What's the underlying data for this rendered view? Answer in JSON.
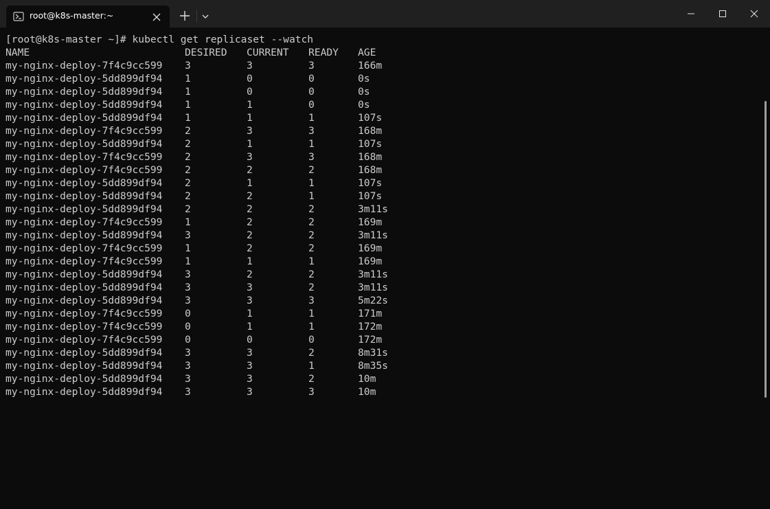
{
  "window": {
    "tab_title": "root@k8s-master:~",
    "icons": {
      "tab": "powershell-terminal-icon",
      "tab_close": "close-icon",
      "new_tab": "plus-icon",
      "dropdown": "chevron-down-icon",
      "minimize": "minimize-icon",
      "maximize": "maximize-icon",
      "close": "close-icon"
    }
  },
  "terminal": {
    "command_line": "[root@k8s-master ~]# kubectl get replicaset --watch",
    "headers": {
      "name": "NAME",
      "desired": "DESIRED",
      "current": "CURRENT",
      "ready": "READY",
      "age": "AGE"
    },
    "rows": [
      {
        "name": "my-nginx-deploy-7f4c9cc599",
        "desired": "3",
        "current": "3",
        "ready": "3",
        "age": "166m"
      },
      {
        "name": "my-nginx-deploy-5dd899df94",
        "desired": "1",
        "current": "0",
        "ready": "0",
        "age": "0s"
      },
      {
        "name": "my-nginx-deploy-5dd899df94",
        "desired": "1",
        "current": "0",
        "ready": "0",
        "age": "0s"
      },
      {
        "name": "my-nginx-deploy-5dd899df94",
        "desired": "1",
        "current": "1",
        "ready": "0",
        "age": "0s"
      },
      {
        "name": "my-nginx-deploy-5dd899df94",
        "desired": "1",
        "current": "1",
        "ready": "1",
        "age": "107s"
      },
      {
        "name": "my-nginx-deploy-7f4c9cc599",
        "desired": "2",
        "current": "3",
        "ready": "3",
        "age": "168m"
      },
      {
        "name": "my-nginx-deploy-5dd899df94",
        "desired": "2",
        "current": "1",
        "ready": "1",
        "age": "107s"
      },
      {
        "name": "my-nginx-deploy-7f4c9cc599",
        "desired": "2",
        "current": "3",
        "ready": "3",
        "age": "168m"
      },
      {
        "name": "my-nginx-deploy-7f4c9cc599",
        "desired": "2",
        "current": "2",
        "ready": "2",
        "age": "168m"
      },
      {
        "name": "my-nginx-deploy-5dd899df94",
        "desired": "2",
        "current": "1",
        "ready": "1",
        "age": "107s"
      },
      {
        "name": "my-nginx-deploy-5dd899df94",
        "desired": "2",
        "current": "2",
        "ready": "1",
        "age": "107s"
      },
      {
        "name": "my-nginx-deploy-5dd899df94",
        "desired": "2",
        "current": "2",
        "ready": "2",
        "age": "3m11s"
      },
      {
        "name": "my-nginx-deploy-7f4c9cc599",
        "desired": "1",
        "current": "2",
        "ready": "2",
        "age": "169m"
      },
      {
        "name": "my-nginx-deploy-5dd899df94",
        "desired": "3",
        "current": "2",
        "ready": "2",
        "age": "3m11s"
      },
      {
        "name": "my-nginx-deploy-7f4c9cc599",
        "desired": "1",
        "current": "2",
        "ready": "2",
        "age": "169m"
      },
      {
        "name": "my-nginx-deploy-7f4c9cc599",
        "desired": "1",
        "current": "1",
        "ready": "1",
        "age": "169m"
      },
      {
        "name": "my-nginx-deploy-5dd899df94",
        "desired": "3",
        "current": "2",
        "ready": "2",
        "age": "3m11s"
      },
      {
        "name": "my-nginx-deploy-5dd899df94",
        "desired": "3",
        "current": "3",
        "ready": "2",
        "age": "3m11s"
      },
      {
        "name": "my-nginx-deploy-5dd899df94",
        "desired": "3",
        "current": "3",
        "ready": "3",
        "age": "5m22s"
      },
      {
        "name": "my-nginx-deploy-7f4c9cc599",
        "desired": "0",
        "current": "1",
        "ready": "1",
        "age": "171m"
      },
      {
        "name": "my-nginx-deploy-7f4c9cc599",
        "desired": "0",
        "current": "1",
        "ready": "1",
        "age": "172m"
      },
      {
        "name": "my-nginx-deploy-7f4c9cc599",
        "desired": "0",
        "current": "0",
        "ready": "0",
        "age": "172m"
      },
      {
        "name": "my-nginx-deploy-5dd899df94",
        "desired": "3",
        "current": "3",
        "ready": "2",
        "age": "8m31s"
      },
      {
        "name": "my-nginx-deploy-5dd899df94",
        "desired": "3",
        "current": "3",
        "ready": "1",
        "age": "8m35s"
      },
      {
        "name": "my-nginx-deploy-5dd899df94",
        "desired": "3",
        "current": "3",
        "ready": "2",
        "age": "10m"
      },
      {
        "name": "my-nginx-deploy-5dd899df94",
        "desired": "3",
        "current": "3",
        "ready": "3",
        "age": "10m"
      }
    ]
  },
  "colors": {
    "background": "#0c0c0c",
    "titlebar": "#202020",
    "text": "#cccccc"
  }
}
